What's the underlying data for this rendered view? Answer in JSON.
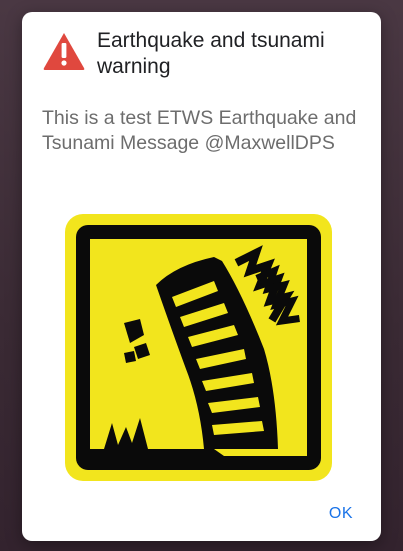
{
  "dialog": {
    "title": "Earthquake and tsunami warning",
    "message": "This is a test ETWS Earthquake and Tsunami Message @MaxwellDPS",
    "ok_label": "OK",
    "icons": {
      "warning": "warning-triangle-icon",
      "hazard": "earthquake-hazard-icon"
    },
    "colors": {
      "warning_red": "#e0483e",
      "hazard_yellow": "#f2e51d",
      "button_blue": "#1a73e8"
    }
  }
}
